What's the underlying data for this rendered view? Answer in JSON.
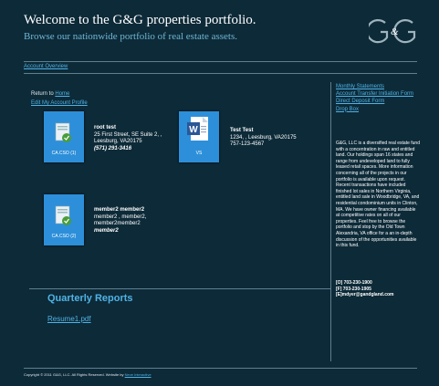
{
  "header": {
    "title": "Welcome to the G&G properties portfolio.",
    "subtitle": "Browse our nationwide portfolio of real estate assets.",
    "logo_text": "G&G"
  },
  "nav": {
    "account_overview": "Account Overview"
  },
  "main": {
    "return_prefix": "Return to",
    "return_link": "Home",
    "edit_profile": "Edit My Account Profile",
    "properties": [
      {
        "tile_label": "CA.CSO (1)",
        "icon": "installer-icon",
        "name": "root test",
        "line1": "25 First Street, SE Suite 2, ,",
        "line2": "Leesburg, VA20175",
        "phone": "(571) 291-3416"
      },
      {
        "tile_label": "VS",
        "icon": "word-document-icon",
        "name": "Test Test",
        "line1": "1234, , Leesburg, VA20175",
        "line2": "757-123-4567",
        "phone": ""
      },
      {
        "tile_label": "CA.CSO (2)",
        "icon": "installer-icon",
        "name": "member2 member2",
        "line1": "member2 , member2,",
        "line2": "member2member2",
        "phone": "member2"
      }
    ],
    "quarterly_title": "Quarterly Reports",
    "resume_link": "Resume1.pdf"
  },
  "sidebar": {
    "links": [
      "Monthly Statements",
      "Account Transfer Initiation Form",
      "Direct Deposit Form",
      "Drop Box"
    ],
    "description": "G&G, LLC is a diversified real estate fund with a concentration in raw and entitled land. Our holdings span 16 states and range from undeveloped land to fully leased retail spaces. More information concerning all of the projects in our portfolio is available upon request. Recent transactions have included finished lot sales in Northern Virginia, entitled land sale in Woodbridge, VA, and residential condominium units in Clinton, MA. We have owner financing available at competitive rates on all of our properties. Feel free to browse the portfolio and stop by the Old Town Alexandria, VA office for a an in-depth discussion of the opportunities available in this fund.",
    "phone": "[O] 703-230-1900",
    "fax": "[F] 703-230-1905",
    "email": "[E]mdyer@gandgland.com"
  },
  "footer": {
    "copyright": "Copyright © 2011 G&G, LLC. All Rights Reserved. Website by",
    "credit_link": "Neve Interactive"
  },
  "colors": {
    "background": "#0d2a38",
    "link": "#4fb3e6",
    "tile": "#2d8fd9",
    "rule": "#5d7f8f"
  }
}
